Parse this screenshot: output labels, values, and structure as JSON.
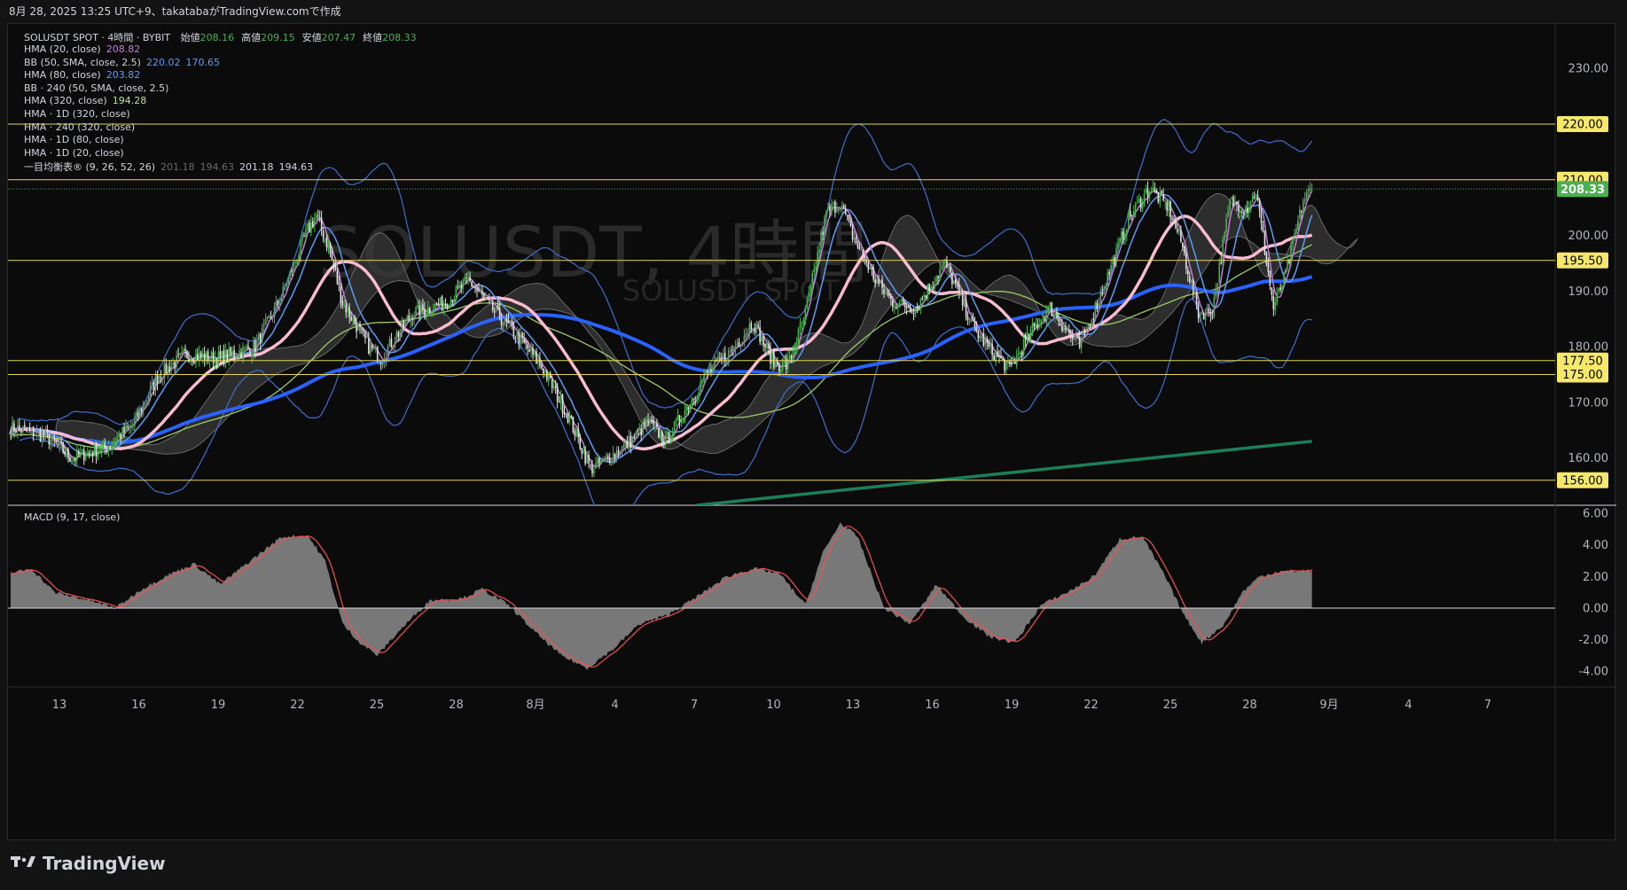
{
  "header": {
    "caption": "8月 28, 2025 13:25 UTC+9、takatabaがTradingView.comで作成"
  },
  "watermark": {
    "title": "SOLUSDT, 4時間",
    "subtitle": "SOLUSDT SPOT"
  },
  "legend": {
    "symbol": "SOLUSDT SPOT · 4時間 · BYBIT",
    "ohlc": [
      {
        "label": "始値",
        "value": "208.16"
      },
      {
        "label": "高値",
        "value": "209.15"
      },
      {
        "label": "安値",
        "value": "207.47"
      },
      {
        "label": "終値",
        "value": "208.33"
      }
    ],
    "indicators": [
      {
        "name": "HMA (20, close)",
        "values": [
          "208.82"
        ],
        "colors": [
          "#c27bd6"
        ]
      },
      {
        "name": "BB (50, SMA, close, 2.5)",
        "values": [
          "220.02",
          "170.65"
        ],
        "colors": [
          "#5b9cf6",
          "#5b9cf6"
        ]
      },
      {
        "name": "HMA (80, close)",
        "values": [
          "203.82"
        ],
        "colors": [
          "#5b9cf6"
        ]
      },
      {
        "name": "BB · 240 (50, SMA, close, 2.5)",
        "values": [],
        "colors": []
      },
      {
        "name": "HMA (320, close)",
        "values": [
          "194.28"
        ],
        "colors": [
          "#b6e38c"
        ]
      },
      {
        "name": "HMA · 1D (320, close)",
        "values": [],
        "colors": []
      },
      {
        "name": "HMA · 240 (320, close)",
        "values": [],
        "colors": []
      },
      {
        "name": "HMA · 1D (80, close)",
        "values": [],
        "colors": []
      },
      {
        "name": "HMA · 1D (20, close)",
        "values": [],
        "colors": []
      },
      {
        "name": "一目均衡表® (9, 26, 52, 26)",
        "values": [
          "201.18",
          "194.63",
          "201.18",
          "194.63"
        ],
        "colors": [
          "#6a6a6a",
          "#6a6a6a",
          "#d1d4dc",
          "#d1d4dc"
        ]
      }
    ]
  },
  "macd_label": "MACD (9, 17, close)",
  "footer": {
    "brand": "TradingView"
  },
  "colors": {
    "up": "#4caf50",
    "down": "#e0e0e0",
    "hma20": "#c27bd6",
    "bb": "#3d6fcf",
    "hma80": "#5b9cf6",
    "hma320": "#9ccc65",
    "pink": "#f8bbd0",
    "blue_thick": "#2962ff",
    "green_long": "#1b7f5a",
    "hline": "#e6d55a",
    "price": "#4caf50",
    "macd_line": "#ef5350",
    "macd_hist": "#8c8c8c"
  },
  "chart_data": [
    {
      "type": "candlestick",
      "symbol": "SOLUSDT SPOT",
      "timeframe": "4時間",
      "exchange": "BYBIT",
      "x_ticks": [
        "13",
        "16",
        "19",
        "22",
        "25",
        "28",
        "8月",
        "4",
        "7",
        "10",
        "13",
        "16",
        "19",
        "22",
        "25",
        "28",
        "9月",
        "4",
        "7"
      ],
      "y_ticks": [
        "230.00",
        "200.00",
        "190.00",
        "180.00",
        "170.00",
        "160.00"
      ],
      "ylim": [
        151.5,
        238
      ],
      "horizontal_levels": [
        220.0,
        210.0,
        195.5,
        177.5,
        175.0,
        156.0
      ],
      "level_labels": [
        "220.00",
        "210.00",
        "195.50",
        "177.50",
        "175.00",
        "156.00"
      ],
      "last_price": 208.33,
      "last_price_label": "208.33",
      "anchors": [
        [
          0,
          165.5
        ],
        [
          20,
          164
        ],
        [
          35,
          160
        ],
        [
          55,
          162
        ],
        [
          70,
          166
        ],
        [
          85,
          175
        ],
        [
          100,
          178.5
        ],
        [
          120,
          178
        ],
        [
          140,
          180
        ],
        [
          155,
          189
        ],
        [
          170,
          201
        ],
        [
          175,
          203.5
        ],
        [
          182,
          198
        ],
        [
          190,
          188
        ],
        [
          205,
          180
        ],
        [
          212,
          178
        ],
        [
          230,
          186
        ],
        [
          250,
          188
        ],
        [
          262,
          192
        ],
        [
          275,
          187
        ],
        [
          290,
          182
        ],
        [
          305,
          176
        ],
        [
          320,
          167
        ],
        [
          332,
          158
        ],
        [
          340,
          159.5
        ],
        [
          355,
          163
        ],
        [
          365,
          166.5
        ],
        [
          375,
          163
        ],
        [
          385,
          168
        ],
        [
          398,
          175
        ],
        [
          412,
          179
        ],
        [
          425,
          184.5
        ],
        [
          437,
          177
        ],
        [
          445,
          176.5
        ],
        [
          455,
          186
        ],
        [
          467,
          204
        ],
        [
          475,
          206
        ],
        [
          482,
          200
        ],
        [
          495,
          192
        ],
        [
          505,
          188
        ],
        [
          518,
          187
        ],
        [
          535,
          195
        ],
        [
          552,
          183
        ],
        [
          562,
          179
        ],
        [
          572,
          176
        ],
        [
          585,
          183
        ],
        [
          595,
          187
        ],
        [
          602,
          184
        ],
        [
          612,
          180
        ],
        [
          625,
          190
        ],
        [
          640,
          203
        ],
        [
          652,
          208.5
        ],
        [
          663,
          205
        ],
        [
          670,
          199
        ],
        [
          680,
          186
        ],
        [
          688,
          186.5
        ],
        [
          698,
          206
        ],
        [
          708,
          205
        ],
        [
          713,
          208
        ],
        [
          723,
          187
        ],
        [
          730,
          193
        ],
        [
          740,
          206.33
        ],
        [
          745,
          208.33
        ]
      ],
      "overlays": [
        "HMA 20",
        "HMA 80",
        "HMA 320",
        "Bollinger Bands 50 2.5",
        "Ichimoku cloud"
      ]
    },
    {
      "type": "area",
      "name": "MACD (9, 17, close)",
      "y_ticks": [
        "6.00",
        "4.00",
        "2.00",
        "0.00",
        "-2.00",
        "-4.00"
      ],
      "ylim": [
        -5.0,
        6.4
      ],
      "anchors": [
        [
          0,
          2.2
        ],
        [
          12,
          2.5
        ],
        [
          25,
          1.0
        ],
        [
          45,
          0.5
        ],
        [
          60,
          0.0
        ],
        [
          75,
          1.2
        ],
        [
          90,
          2.1
        ],
        [
          105,
          2.8
        ],
        [
          120,
          1.5
        ],
        [
          135,
          2.8
        ],
        [
          155,
          4.5
        ],
        [
          170,
          4.6
        ],
        [
          180,
          3.0
        ],
        [
          190,
          -1.0
        ],
        [
          200,
          -2.2
        ],
        [
          210,
          -3.0
        ],
        [
          222,
          -1.5
        ],
        [
          240,
          0.5
        ],
        [
          258,
          0.6
        ],
        [
          270,
          1.2
        ],
        [
          285,
          0.2
        ],
        [
          300,
          -1.5
        ],
        [
          315,
          -3.0
        ],
        [
          330,
          -3.8
        ],
        [
          345,
          -2.6
        ],
        [
          360,
          -1.0
        ],
        [
          375,
          -0.5
        ],
        [
          390,
          0.5
        ],
        [
          410,
          2.0
        ],
        [
          425,
          2.5
        ],
        [
          440,
          2.2
        ],
        [
          455,
          0.2
        ],
        [
          465,
          3.5
        ],
        [
          475,
          5.4
        ],
        [
          485,
          4.5
        ],
        [
          500,
          0.0
        ],
        [
          515,
          -1.0
        ],
        [
          530,
          1.5
        ],
        [
          545,
          -0.5
        ],
        [
          560,
          -1.8
        ],
        [
          575,
          -2.2
        ],
        [
          590,
          0.2
        ],
        [
          605,
          1.0
        ],
        [
          620,
          2.0
        ],
        [
          635,
          4.4
        ],
        [
          648,
          4.5
        ],
        [
          660,
          2.2
        ],
        [
          672,
          -0.5
        ],
        [
          682,
          -2.2
        ],
        [
          695,
          -1.0
        ],
        [
          705,
          1.0
        ],
        [
          715,
          2.0
        ],
        [
          725,
          2.3
        ],
        [
          745,
          2.4
        ]
      ]
    }
  ]
}
